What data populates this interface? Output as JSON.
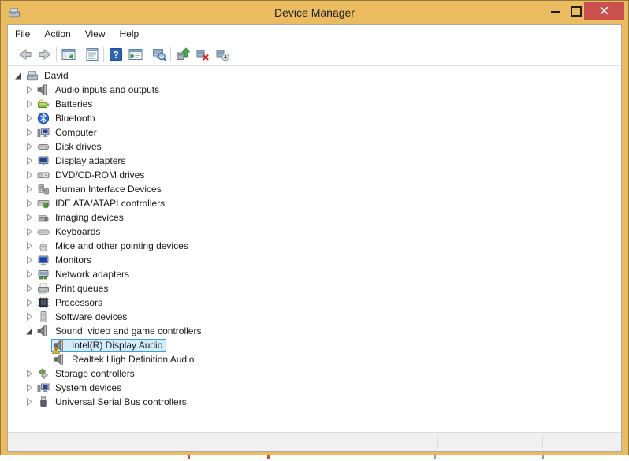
{
  "window": {
    "title": "Device Manager",
    "controls": [
      "minimize",
      "maximize",
      "close"
    ]
  },
  "menu": {
    "items": [
      "File",
      "Action",
      "View",
      "Help"
    ]
  },
  "toolbar": {
    "buttons": [
      "back",
      "forward",
      "separator",
      "show-console-tree",
      "separator",
      "properties",
      "separator",
      "help",
      "show-action-pane",
      "separator",
      "scan-for-hardware-changes",
      "separator",
      "update-driver",
      "uninstall-device",
      "disable-device"
    ]
  },
  "tree": {
    "items": [
      {
        "label": "David",
        "level": 0,
        "state": "expanded",
        "icon": "device-manager"
      },
      {
        "label": "Audio inputs and outputs",
        "level": 1,
        "state": "collapsed",
        "icon": "speaker"
      },
      {
        "label": "Batteries",
        "level": 1,
        "state": "collapsed",
        "icon": "battery"
      },
      {
        "label": "Bluetooth",
        "level": 1,
        "state": "collapsed",
        "icon": "bluetooth"
      },
      {
        "label": "Computer",
        "level": 1,
        "state": "collapsed",
        "icon": "computer"
      },
      {
        "label": "Disk drives",
        "level": 1,
        "state": "collapsed",
        "icon": "disk-drive"
      },
      {
        "label": "Display adapters",
        "level": 1,
        "state": "collapsed",
        "icon": "display-adapter"
      },
      {
        "label": "DVD/CD-ROM drives",
        "level": 1,
        "state": "collapsed",
        "icon": "dvd-drive"
      },
      {
        "label": "Human Interface Devices",
        "level": 1,
        "state": "collapsed",
        "icon": "hid-device"
      },
      {
        "label": "IDE ATA/ATAPI controllers",
        "level": 1,
        "state": "collapsed",
        "icon": "ide-controller"
      },
      {
        "label": "Imaging devices",
        "level": 1,
        "state": "collapsed",
        "icon": "imaging-device"
      },
      {
        "label": "Keyboards",
        "level": 1,
        "state": "collapsed",
        "icon": "keyboard"
      },
      {
        "label": "Mice and other pointing devices",
        "level": 1,
        "state": "collapsed",
        "icon": "mouse"
      },
      {
        "label": "Monitors",
        "level": 1,
        "state": "collapsed",
        "icon": "monitor"
      },
      {
        "label": "Network adapters",
        "level": 1,
        "state": "collapsed",
        "icon": "network-adapter"
      },
      {
        "label": "Print queues",
        "level": 1,
        "state": "collapsed",
        "icon": "printer"
      },
      {
        "label": "Processors",
        "level": 1,
        "state": "collapsed",
        "icon": "processor"
      },
      {
        "label": "Software devices",
        "level": 1,
        "state": "collapsed",
        "icon": "software-device"
      },
      {
        "label": "Sound, video and game controllers",
        "level": 1,
        "state": "expanded",
        "icon": "speaker"
      },
      {
        "label": "Intel(R) Display Audio",
        "level": 2,
        "state": "leaf",
        "icon": "speaker",
        "selected": true,
        "warning": true
      },
      {
        "label": "Realtek High Definition Audio",
        "level": 2,
        "state": "leaf",
        "icon": "speaker"
      },
      {
        "label": "Storage controllers",
        "level": 1,
        "state": "collapsed",
        "icon": "storage-controller"
      },
      {
        "label": "System devices",
        "level": 1,
        "state": "collapsed",
        "icon": "computer"
      },
      {
        "label": "Universal Serial Bus controllers",
        "level": 1,
        "state": "collapsed",
        "icon": "usb-controller"
      }
    ]
  },
  "statusbar": {
    "text": ""
  },
  "colors": {
    "titlebar": "#eabc5f",
    "close_button": "#c9504c",
    "selection_bg": "#d3ecfa",
    "selection_border": "#3d9dd4"
  }
}
